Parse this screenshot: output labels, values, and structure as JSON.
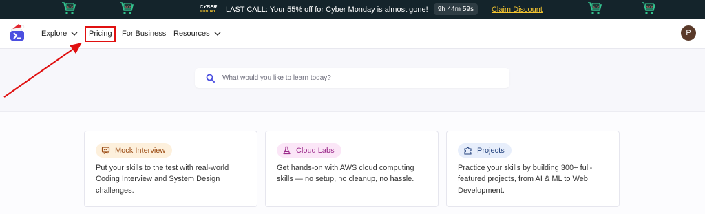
{
  "banner": {
    "logo_line1": "CYBER",
    "logo_line2": "MONDAY",
    "message": "LAST CALL: Your 55% off for Cyber Monday is almost gone!",
    "timer": "9h 44m 59s",
    "claim_label": "Claim Discount",
    "background": "#14242b",
    "accent": "#f4c430"
  },
  "nav": {
    "explore_label": "Explore",
    "pricing_label": "Pricing",
    "business_label": "For Business",
    "resources_label": "Resources",
    "avatar_initial": "P"
  },
  "search": {
    "placeholder": "What would you like to learn today?"
  },
  "cards": [
    {
      "label": "Mock Interview",
      "description": "Put your skills to the test with real-world Coding Interview and System Design challenges.",
      "icon": "whiteboard-icon",
      "pill_bg": "#fdf0dc",
      "pill_color": "#9a4a12"
    },
    {
      "label": "Cloud Labs",
      "description": "Get hands-on with AWS cloud computing skills — no setup, no cleanup, no hassle.",
      "icon": "flask-icon",
      "pill_bg": "#fbe6f7",
      "pill_color": "#9b2a8a"
    },
    {
      "label": "Projects",
      "description": "Practice your skills by building 300+ full-featured projects, from AI & ML to Web Development.",
      "icon": "puzzle-icon",
      "pill_bg": "#e7eefb",
      "pill_color": "#1f3e7a"
    }
  ],
  "annotation_color": "#e01010"
}
